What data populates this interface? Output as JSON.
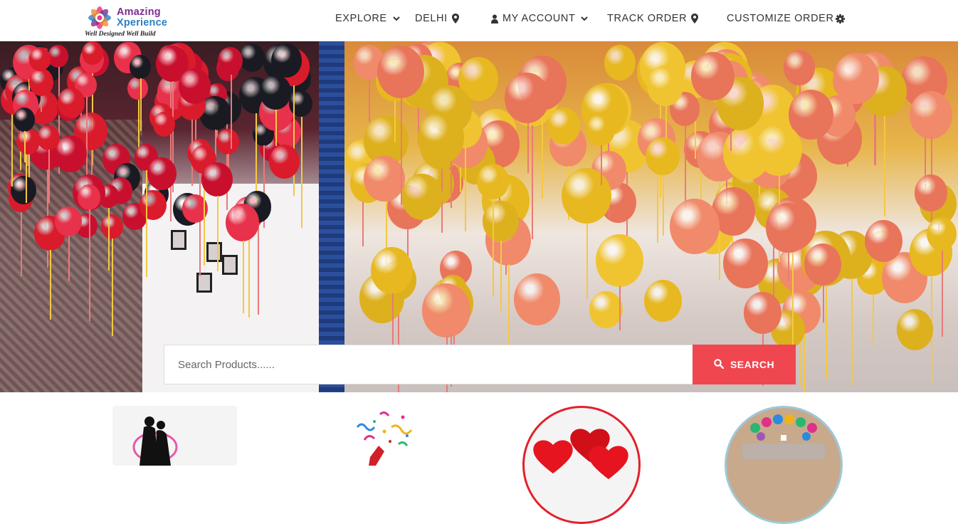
{
  "brand": {
    "name_line1": "Amazing",
    "name_line2": "Xperience",
    "tagline": "Well Designed Well Build"
  },
  "nav": {
    "explore": "EXPLORE",
    "city": "DELHI",
    "account": "MY ACCOUNT",
    "track_order": "TRACK ORDER",
    "customize_order": "CUSTOMIZE ORDER"
  },
  "icons": {
    "explore": "chevron-down-icon",
    "city": "map-marker-icon",
    "account_user": "user-icon",
    "account_chevron": "chevron-down-icon",
    "track_order": "map-marker-icon",
    "customize_order": "settings-icon",
    "search": "search-icon"
  },
  "search": {
    "placeholder": "Search Products......",
    "value": "",
    "button_label": "SEARCH"
  },
  "colors": {
    "accent": "#f0464f",
    "brand_purple": "#7d2d8f",
    "nav_text": "#333333"
  },
  "categories": [
    {
      "icon": "couple-silhouette-icon"
    },
    {
      "icon": "party-popper-icon"
    },
    {
      "icon": "heart-balloons-icon"
    },
    {
      "icon": "congrats-board-icon"
    }
  ]
}
